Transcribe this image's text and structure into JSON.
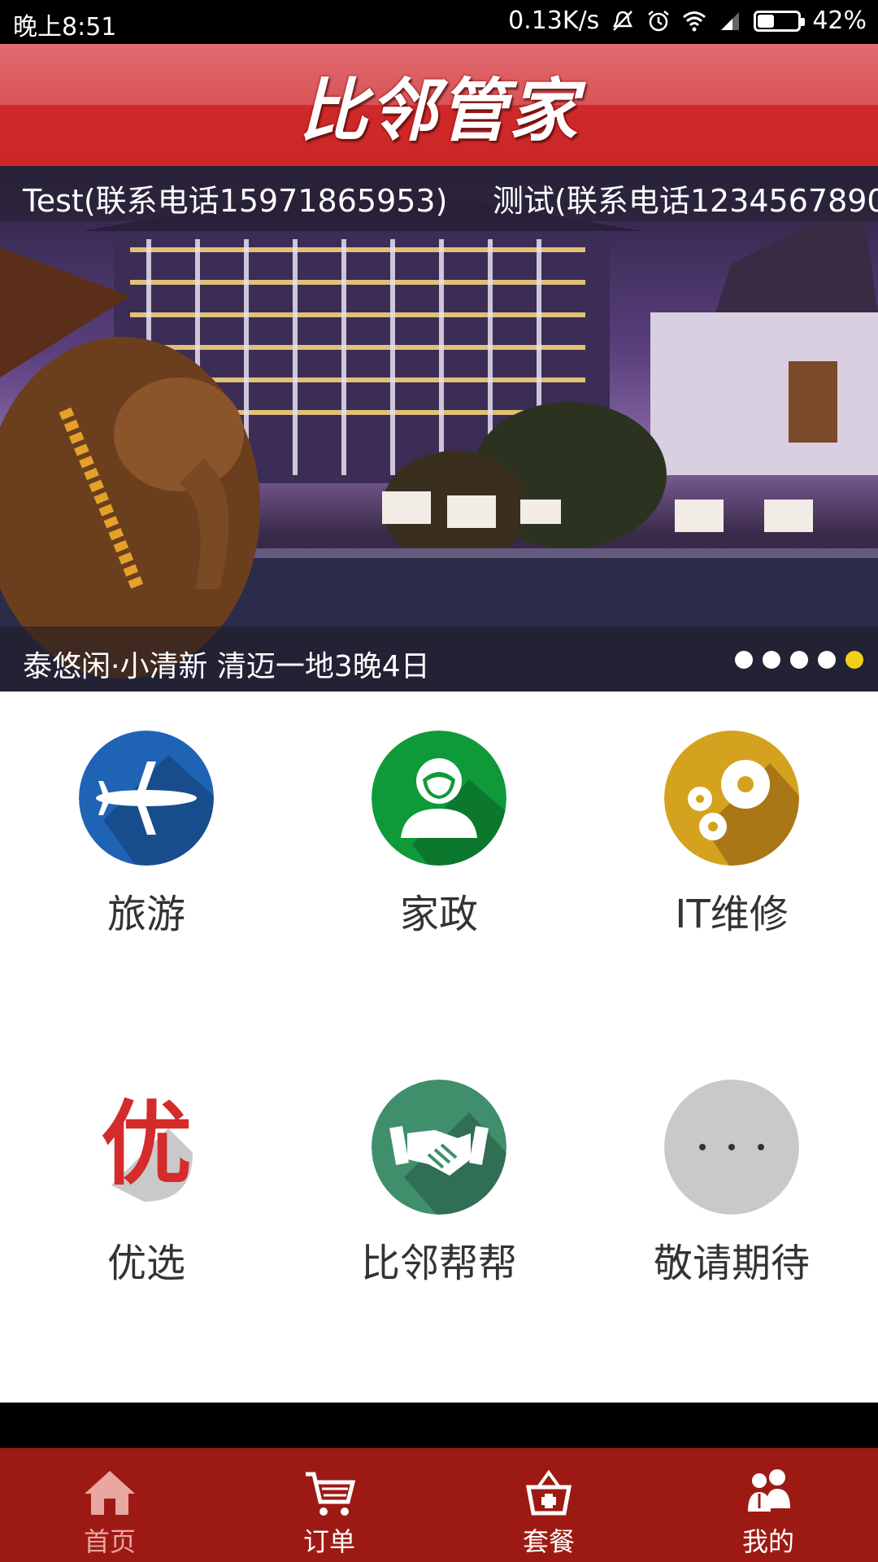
{
  "status_bar": {
    "time": "晚上8:51",
    "speed": "0.13K/s",
    "battery": "42%",
    "battery_level": 0.42
  },
  "header": {
    "title": "比邻管家"
  },
  "banner": {
    "ticker": [
      "Test(联系电话15971865953)",
      "测试(联系电话1234567890"
    ],
    "caption": "泰悠闲·小清新 清迈一地3晚4日",
    "slide_count": 5,
    "active_slide": 5
  },
  "services": [
    {
      "label": "旅游",
      "icon": "airplane-icon",
      "color": "#1f63b5"
    },
    {
      "label": "家政",
      "icon": "housekeeper-icon",
      "color": "#0f9a3a"
    },
    {
      "label": "IT维修",
      "icon": "gears-icon",
      "color": "#d4a21e"
    },
    {
      "label": "优选",
      "icon": "you-character-icon",
      "color": "#d42b2b"
    },
    {
      "label": "比邻帮帮",
      "icon": "handshake-icon",
      "color": "#3f8f6d"
    },
    {
      "label": "敬请期待",
      "icon": "more-dots-icon",
      "color": "#c9c9c9"
    }
  ],
  "you_glyph": "优",
  "bottom_nav": [
    {
      "label": "首页",
      "icon": "home-icon",
      "color": "#e8a7a0"
    },
    {
      "label": "订单",
      "icon": "cart-icon",
      "color": "#ffffff"
    },
    {
      "label": "套餐",
      "icon": "basket-icon",
      "color": "#ffffff"
    },
    {
      "label": "我的",
      "icon": "people-icon",
      "color": "#ffffff"
    }
  ]
}
